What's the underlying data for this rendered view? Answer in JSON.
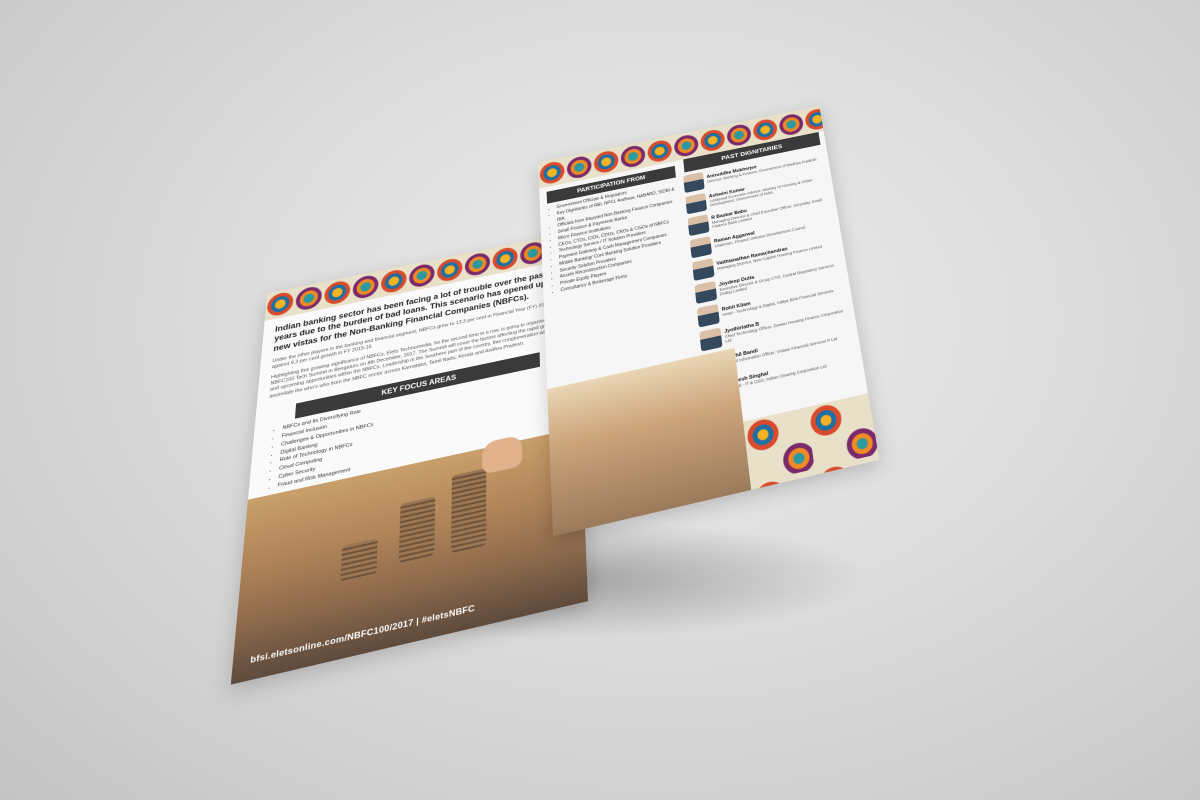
{
  "left_page": {
    "intro": "Indian banking sector has been facing a lot of trouble over the past few years due to the burden of bad loans. This scenario has opened up new vistas for the Non-Banking Financial Companies (NBFCs).",
    "para1": "Under the other players in the banking and financial segment, NBFCs grew to 13.3 per cent in Financial Year (FY) 2016-17 as against 9.2 per cent growth in FY 2015-16.",
    "para2": "Highlighting this growing significance of NBFCs, Elets Technomedia, for the second time in a row, is going to organise the NBFC100 Tech Summit in Bengaluru on 8th December, 2017. The Summit will cover the factors affecting the rapid growth and upcoming opportunities within the NBFCs. Leadership in the Southern part of the country, this conglomeration will assimilate the who's who from the NBFC sector across Karnataka, Tamil Nadu, Kerala and Andhra Pradesh.",
    "focus_title": "KEY FOCUS AREAS",
    "focus_items": [
      "NBFCs and Its Diversifying Role",
      "Financial Inclusion",
      "Challenges & Opportunities in NBFCs",
      "Digital Banking",
      "Role of Technology in NBFCs",
      "Cloud Computing",
      "Cyber Security",
      "Fraud and Risk Management"
    ],
    "url": "bfsi.eletsonline.com/NBFC100/2017 | #eletsNBFC"
  },
  "right_page": {
    "participation_title": "PARTICIPATION FROM",
    "participation_items": [
      "Government Officials & Regulators",
      "Key Dignitaries of RBI, NPCI, Aadhaar, NABARD, SIDBI & IBA",
      "Officials from Reputed Non-Banking Finance Companies",
      "Small Finance & Payments Banks",
      "Micro Finance Institutions",
      "CEOs, CTOs, CIOs, CDOs, CROs & CISOs of NBFCs",
      "Technology Service / IT Solution Providers",
      "Payment Gateway & Cash Management Companies",
      "Mobile Banking/ Core Banking Solution Providers",
      "Security Solution Providers",
      "Assets Reconstruction Companies",
      "Private Equity Players",
      "Consultancy & Brokerage Firms"
    ],
    "dignitaries_title": "PAST DIGNITARIES",
    "dignitaries": [
      {
        "name": "Aniruddha Mukherjee",
        "role": "Director, Banking & Finance, Government of Madhya Pradesh"
      },
      {
        "name": "Ashwini Kumar",
        "role": "Additional Economic Advisor, Ministry of Housing & Urban Development, Government of India"
      },
      {
        "name": "R Baskar Babu",
        "role": "Managing Director & Chief Executive Officer, Suryoday Small Finance Bank Limited"
      },
      {
        "name": "Raman Aggarwal",
        "role": "Chairman, Finance Industry Development Council"
      },
      {
        "name": "Vaithianathan Ramachandran",
        "role": "Managing Director, New Capital Housing Finance Limited"
      },
      {
        "name": "Joydeep Dutta",
        "role": "Executive Director & Group CTO, Central Depository Services (India) Limited"
      },
      {
        "name": "Rohit Kilam",
        "role": "Head - Technology & Digital, Aditya Birla Financial Services"
      },
      {
        "name": "Jyothirlatha B",
        "role": "Chief Technology Officer, Dewan Housing Finance Corporation Ltd"
      },
      {
        "name": "Nikhil Bandi",
        "role": "Chief Information Officer, Vistaar Financial Services P Ltd"
      },
      {
        "name": "Rajesh Singhal",
        "role": "Head - IT & OSO, Indian Clearing Corporation Ltd"
      }
    ]
  }
}
